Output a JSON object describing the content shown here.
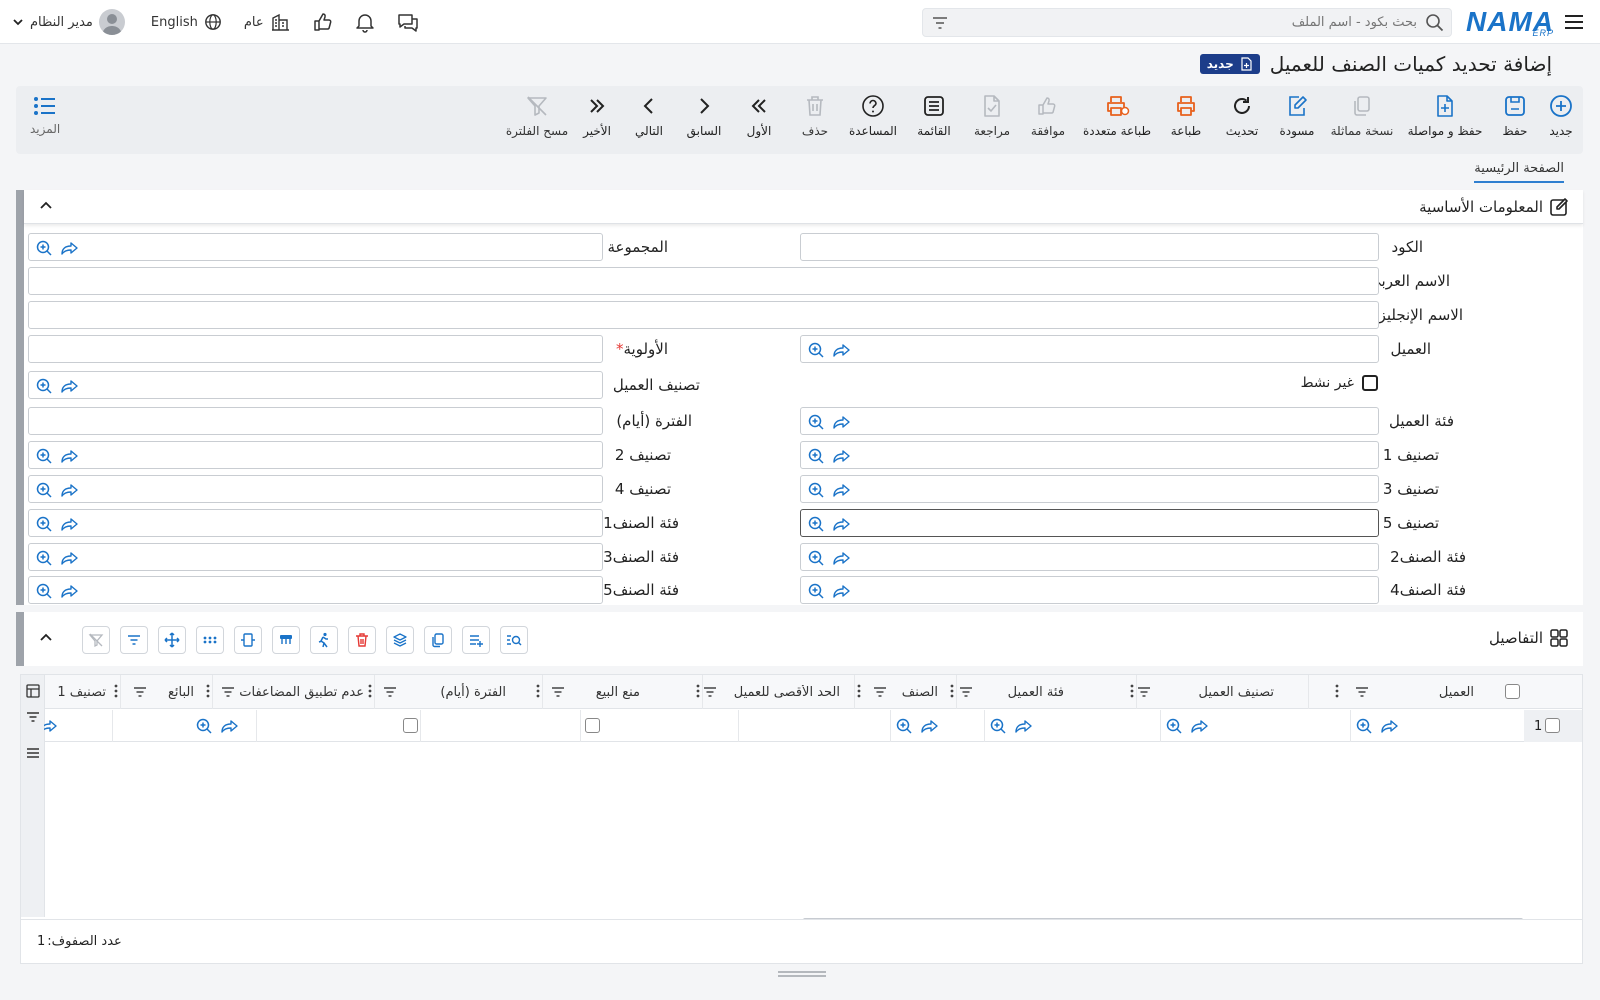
{
  "topbar": {
    "logo": "NAMA",
    "logo_sub": "ERP",
    "search_placeholder": "بحث بكود - اسم الملف",
    "user_name": "مدير النظام",
    "language": "English",
    "branch": "عام"
  },
  "page": {
    "title": "إضافة تحديد كميات الصنف للعميل",
    "badge": "جديد"
  },
  "toolbar": {
    "new": "جديد",
    "save": "حفظ",
    "save_continue": "حفظ و مواصلة",
    "duplicate": "نسخة مماثلة",
    "draft": "مسودة",
    "refresh": "تحديث",
    "print": "طباعة",
    "multi_print": "طباعة متعددة",
    "approve": "موافقة",
    "review": "مراجعة",
    "list": "القائمة",
    "help": "المساعدة",
    "delete": "حذف",
    "first": "الأول",
    "previous": "السابق",
    "next": "التالي",
    "last": "الأخير",
    "clear_filter": "مسح الفلترة",
    "more": "المزيد"
  },
  "tabs": {
    "main": "الصفحة الرئيسية"
  },
  "basic_info": {
    "title": "المعلومات الأساسية",
    "code": "الكود",
    "group": "المجموعة",
    "arabic_name": "الاسم العربي",
    "english_name": "الاسم الإنجليزي",
    "customer": "العميل",
    "priority": "الأولوية",
    "required_mark": "*",
    "inactive": "غير نشط",
    "customer_classification": "تصنيف العميل",
    "customer_category": "فئة العميل",
    "period_days": "الفترة (أيام)",
    "class1": "تصنيف 1",
    "class2": "تصنيف 2",
    "class3": "تصنيف 3",
    "class4": "تصنيف 4",
    "class5": "تصنيف 5",
    "item_cat1": "فئة الصنف1",
    "item_cat2": "فئة الصنف2",
    "item_cat3": "فئة الصنف3",
    "item_cat4": "فئة الصنف4",
    "item_cat5": "فئة الصنف5"
  },
  "details": {
    "title": "التفاصيل",
    "columns": [
      "العميل",
      "تصنيف العميل",
      "فئة العميل",
      "الصنف",
      "الحد الأقصى للعميل",
      "منع البيع",
      "الفترة (أيام)",
      "عدم تطبيق المضاعفات",
      "البائع",
      "تصنيف 1"
    ],
    "row_number": "1",
    "row_count_label": "عدد الصفوف:",
    "row_count": "1"
  },
  "colors": {
    "accent": "#1a73c8",
    "badge": "#1c3d8a",
    "print_orange": "#e8601c",
    "tab_underline": "#2f7fd0"
  }
}
